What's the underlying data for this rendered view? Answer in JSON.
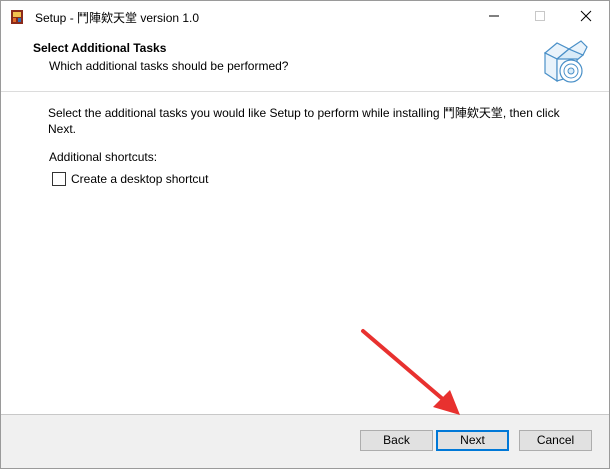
{
  "window": {
    "title": "Setup - 鬥陣欸天堂 version 1.0",
    "controls": {
      "minimize_icon": "minimize-icon",
      "maximize_icon": "maximize-icon",
      "close_icon": "close-icon"
    }
  },
  "header": {
    "title": "Select Additional Tasks",
    "subtitle": "Which additional tasks should be performed?",
    "icon": "installer-box-disc-icon"
  },
  "content": {
    "description_line1": "Select the additional tasks you would like Setup to perform while installing 鬥陣欸天堂, then click",
    "description_line2": "Next.",
    "shortcuts_label": "Additional shortcuts:",
    "desktop_shortcut": {
      "label": "Create a desktop shortcut",
      "checked": false
    }
  },
  "buttons": {
    "back": "Back",
    "next": "Next",
    "cancel": "Cancel"
  },
  "annotation": {
    "color": "#e8312f",
    "icon": "red-arrow-pointer"
  }
}
